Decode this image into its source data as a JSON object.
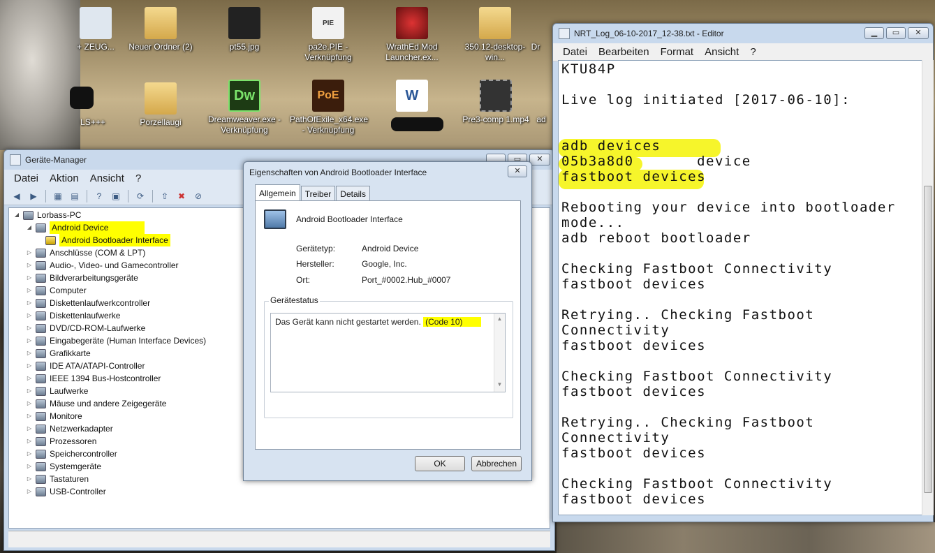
{
  "desktop": {
    "icons": [
      {
        "label": "+ ZEUG...",
        "icon": "shortcut-icon"
      },
      {
        "label": "Neuer Ordner (2)",
        "icon": "folder-icon"
      },
      {
        "label": "pt55.jpg",
        "icon": "image-icon"
      },
      {
        "label": "pa2e.PIE - Verknüpfung",
        "icon": "shortcut-icon"
      },
      {
        "label": "WrathEd Mod Launcher.ex...",
        "icon": "app-icon"
      },
      {
        "label": "350.12-desktop-win...",
        "icon": "folder-icon"
      },
      {
        "label": "Dr",
        "icon": "app-icon"
      },
      {
        "label": "LS+++",
        "icon": "app-icon"
      },
      {
        "label": "Porzellaugi",
        "icon": "folder-icon"
      },
      {
        "label": "Dreamweaver.exe - Verknüpfung",
        "icon": "dreamweaver-icon"
      },
      {
        "label": "PathOfExile_x64.exe - Verknüpfung",
        "icon": "poe-icon"
      },
      {
        "label": "Pre3-comp 1.mp4",
        "icon": "video-icon"
      },
      {
        "label": "ad",
        "icon": "app-icon"
      }
    ]
  },
  "devmgr": {
    "title": "Geräte-Manager",
    "menu": [
      "Datei",
      "Aktion",
      "Ansicht",
      "?"
    ],
    "tree": {
      "root": "Lorbass-PC",
      "android_device": "Android Device",
      "bootloader": "Android Bootloader Interface",
      "items": [
        "Anschlüsse (COM & LPT)",
        "Audio-, Video- und Gamecontroller",
        "Bildverarbeitungsgeräte",
        "Computer",
        "Diskettenlaufwerkcontroller",
        "Diskettenlaufwerke",
        "DVD/CD-ROM-Laufwerke",
        "Eingabegeräte (Human Interface Devices)",
        "Grafikkarte",
        "IDE ATA/ATAPI-Controller",
        "IEEE 1394 Bus-Hostcontroller",
        "Laufwerke",
        "Mäuse und andere Zeigegeräte",
        "Monitore",
        "Netzwerkadapter",
        "Prozessoren",
        "Speichercontroller",
        "Systemgeräte",
        "Tastaturen",
        "USB-Controller"
      ]
    }
  },
  "props": {
    "title": "Eigenschaften von Android Bootloader Interface",
    "tabs": [
      "Allgemein",
      "Treiber",
      "Details"
    ],
    "device_name": "Android Bootloader Interface",
    "fields": [
      {
        "label": "Gerätetyp:",
        "value": "Android Device"
      },
      {
        "label": "Hersteller:",
        "value": "Google, Inc."
      },
      {
        "label": "Ort:",
        "value": "Port_#0002.Hub_#0007"
      }
    ],
    "status_group": "Gerätestatus",
    "status_text": "Das Gerät kann nicht gestartet werden.",
    "status_code": "(Code 10)",
    "ok": "OK",
    "cancel": "Abbrechen"
  },
  "notepad": {
    "title": "NRT_Log_06-10-2017_12-38.txt - Editor",
    "menu": [
      "Datei",
      "Bearbeiten",
      "Format",
      "Ansicht",
      "?"
    ],
    "lines": [
      "KTU84P",
      "",
      "Live log initiated [2017-06-10]:",
      "",
      "",
      "adb devices",
      "05b3a8d0       device",
      "fastboot devices",
      "",
      "Rebooting your device into bootloader",
      "mode...",
      "adb reboot bootloader",
      "",
      "Checking Fastboot Connectivity",
      "fastboot devices",
      "",
      "Retrying.. Checking Fastboot",
      "Connectivity",
      "fastboot devices",
      "",
      "Checking Fastboot Connectivity",
      "fastboot devices",
      "",
      "Retrying.. Checking Fastboot",
      "Connectivity",
      "fastboot devices",
      "",
      "Checking Fastboot Connectivity",
      "fastboot devices"
    ]
  },
  "colors": {
    "highlight": "#ffff00",
    "marker": "#f6f52b"
  }
}
